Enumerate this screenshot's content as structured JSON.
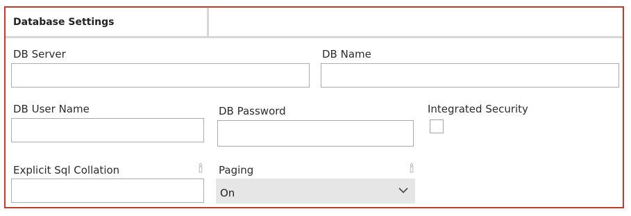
{
  "tab": {
    "title": "Database Settings"
  },
  "fields": {
    "db_server": {
      "label": "DB Server",
      "value": ""
    },
    "db_name": {
      "label": "DB Name",
      "value": ""
    },
    "db_user_name": {
      "label": "DB User Name",
      "value": ""
    },
    "db_password": {
      "label": "DB Password",
      "value": ""
    },
    "integrated_security": {
      "label": "Integrated Security",
      "checked": false
    },
    "explicit_sql_collation": {
      "label": "Explicit Sql Collation",
      "value": "",
      "icon": "info-icon"
    },
    "paging": {
      "label": "Paging",
      "selected": "On",
      "icon": "info-icon"
    }
  },
  "colors": {
    "frame_border": "#c0392b",
    "input_border": "#ababab",
    "select_background": "#e6e6e6"
  }
}
